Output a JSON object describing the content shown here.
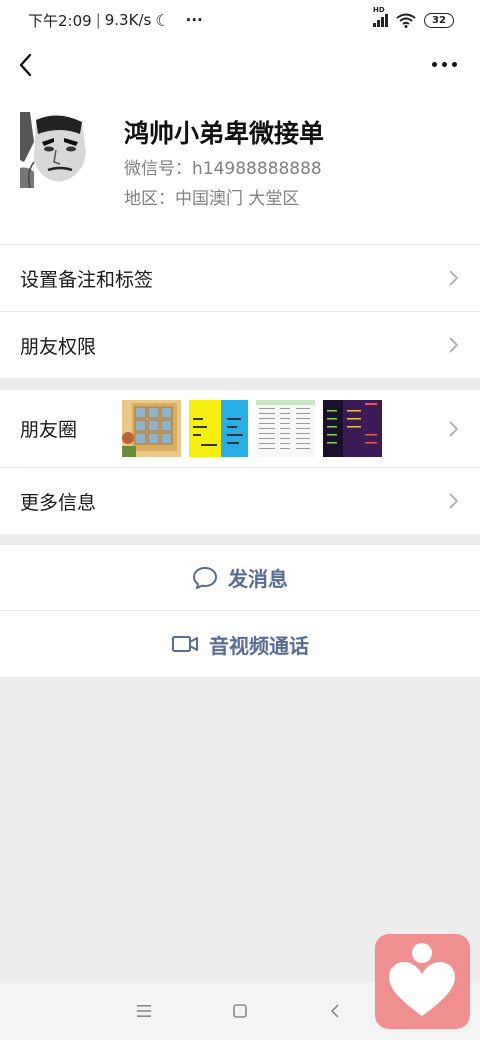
{
  "status_bar": {
    "time": "下午2:09",
    "speed": "9.3K/s",
    "moon": "☾",
    "dots": "···",
    "network": "HD",
    "battery": "32"
  },
  "header": {
    "back_icon": "chevron-left-icon",
    "more_icon": "more-dots-icon"
  },
  "profile": {
    "name": "鸿帅小弟卑微接单",
    "wechat_id": "微信号：h14988888888",
    "region": "地区：中国澳门  大堂区"
  },
  "rows": {
    "remark_label": "设置备注和标签",
    "permission_label": "朋友权限",
    "moments_label": "朋友圈",
    "more_info_label": "更多信息"
  },
  "actions": {
    "message_label": "发消息",
    "video_label": "音视频通话"
  },
  "colors": {
    "link": "#576b95",
    "background": "#ededed",
    "floating_button": "#f08f8f"
  }
}
